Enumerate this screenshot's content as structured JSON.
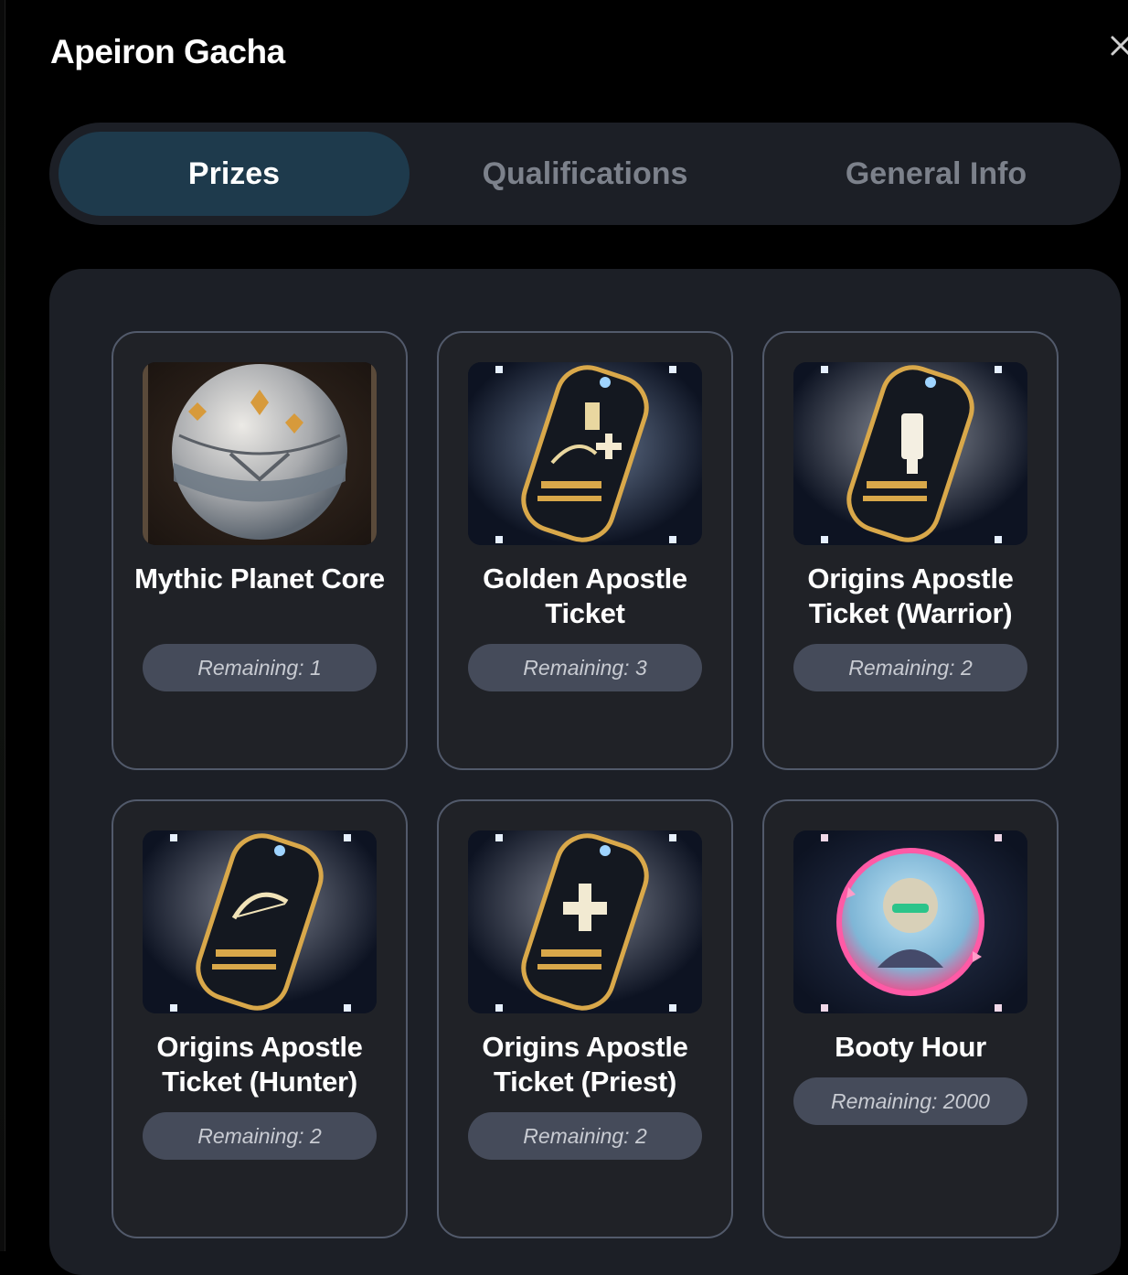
{
  "modal": {
    "title": "Apeiron Gacha",
    "close_icon": "close-icon"
  },
  "tabs": [
    {
      "label": "Prizes",
      "active": true
    },
    {
      "label": "Qualifications",
      "active": false
    },
    {
      "label": "General Info",
      "active": false
    }
  ],
  "prizes": [
    {
      "name": "Mythic Planet Core",
      "remaining": "Remaining: 1",
      "image": "planet-core-image"
    },
    {
      "name": "Golden Apostle Ticket",
      "remaining": "Remaining: 3",
      "image": "golden-ticket-image"
    },
    {
      "name": "Origins Apostle Ticket (Warrior)",
      "remaining": "Remaining: 2",
      "image": "warrior-ticket-image"
    },
    {
      "name": "Origins Apostle Ticket (Hunter)",
      "remaining": "Remaining: 2",
      "image": "hunter-ticket-image"
    },
    {
      "name": "Origins Apostle Ticket (Priest)",
      "remaining": "Remaining: 2",
      "image": "priest-ticket-image"
    },
    {
      "name": "Booty Hour",
      "remaining": "Remaining: 2000",
      "image": "booty-hour-image"
    }
  ],
  "colors": {
    "background": "#000000",
    "panel": "#1c1f26",
    "active_tab": "#1e3a4c",
    "card_border": "#525a6b",
    "badge": "#454b5a"
  }
}
